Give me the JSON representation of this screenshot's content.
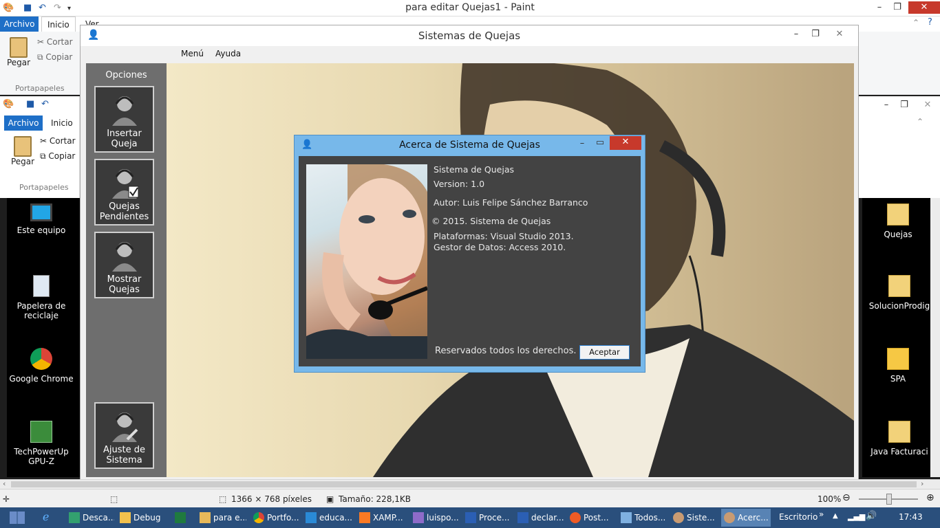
{
  "paint": {
    "title": "para editar Quejas1 - Paint",
    "tab_file": "Archivo",
    "tab_home": "Inicio",
    "tab_view": "Ver",
    "paste_label": "Pegar",
    "cut_label": "Cortar",
    "copy_label": "Copiar",
    "group_clipboard": "Portapapeles",
    "status": {
      "dimensions": "1366 × 768 píxeles",
      "size": "Tamaño: 228,1KB",
      "zoom": "100%"
    }
  },
  "desktop": {
    "left_icons": [
      {
        "label": "Este equipo",
        "icon": "computer-icon"
      },
      {
        "label": "Papelera de reciclaje",
        "icon": "recycle-bin-icon"
      },
      {
        "label": "Google Chrome",
        "icon": "chrome-icon"
      },
      {
        "label": "TechPowerUp GPU-Z",
        "icon": "gpuz-icon"
      }
    ],
    "right_icons": [
      {
        "label": "Quejas",
        "icon": "folder-icon"
      },
      {
        "label": "SolucionProdig",
        "icon": "folder-icon"
      },
      {
        "label": "SPA",
        "icon": "folder-icon"
      },
      {
        "label": "Java Facturaci",
        "icon": "folder-icon"
      }
    ]
  },
  "app": {
    "title": "Sistemas de Quejas",
    "menu": [
      "Menú",
      "Ayuda"
    ],
    "sidebar_header": "Opciones",
    "buttons": [
      {
        "label1": "Insertar",
        "label2": "Queja"
      },
      {
        "label1": "Quejas",
        "label2": "Pendientes"
      },
      {
        "label1": "Mostrar",
        "label2": "Quejas"
      },
      {
        "label1": "Ajuste de",
        "label2": "Sistema"
      }
    ]
  },
  "about": {
    "title": "Acerca de Sistema de Quejas",
    "product": "Sistema de Quejas",
    "version": "Version: 1.0",
    "author": "Autor: Luis Felipe Sánchez Barranco",
    "copyright": "© 2015. Sistema de Quejas",
    "platforms": "Plataformas: Visual Studio 2013.",
    "db": "Gestor de Datos: Access 2010.",
    "rights": "Reservados todos los derechos.",
    "ok": "Aceptar"
  },
  "taskbar": {
    "items": [
      {
        "label": "Desca...",
        "icon": "download-icon"
      },
      {
        "label": "Debug",
        "icon": "folder-icon"
      },
      {
        "label": "",
        "icon": "excel-icon"
      },
      {
        "label": "para e...",
        "icon": "paint-icon"
      },
      {
        "label": "Portfo...",
        "icon": "chrome-icon"
      },
      {
        "label": "educa...",
        "icon": "vscode-icon"
      },
      {
        "label": "XAMP...",
        "icon": "xampp-icon"
      },
      {
        "label": "luispo...",
        "icon": "browser-icon"
      },
      {
        "label": "Proce...",
        "icon": "word-icon"
      },
      {
        "label": "declar...",
        "icon": "word-icon"
      },
      {
        "label": "Post...",
        "icon": "postman-icon"
      },
      {
        "label": "Todos...",
        "icon": "window-icon"
      },
      {
        "label": "Siste...",
        "icon": "agent-icon"
      },
      {
        "label": "Acerc...",
        "icon": "agent-icon"
      }
    ],
    "desktop_label": "Escritorio",
    "clock": "17:43"
  },
  "colors": {
    "accent": "#1e6fc7",
    "dialog_frame": "#77b8ea",
    "close_red": "#c7392b",
    "taskbar": "#2a4f7c"
  }
}
